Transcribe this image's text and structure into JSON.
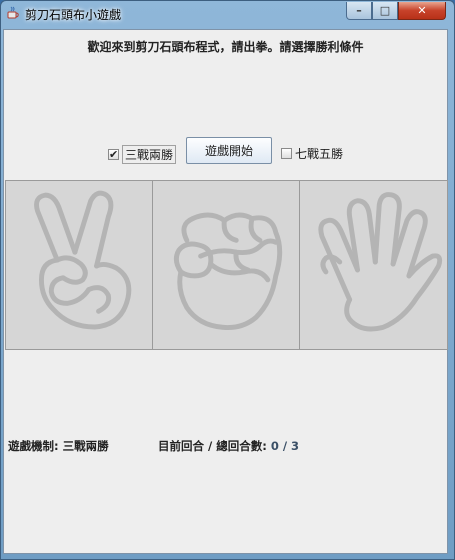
{
  "window": {
    "title": "剪刀石頭布小遊戲",
    "buttons": {
      "minimize": "–",
      "maximize": "□",
      "close": "✕"
    }
  },
  "welcome_text": "歡迎來到剪刀石頭布程式，請出拳。請選擇勝利條件",
  "options": {
    "best_of_three": {
      "label": "三戰兩勝",
      "checked": true
    },
    "start_button": "遊戲開始",
    "best_of_seven": {
      "label": "七戰五勝",
      "checked": false
    }
  },
  "hands": [
    {
      "name": "scissors",
      "icon": "scissors-hand-icon"
    },
    {
      "name": "rock",
      "icon": "rock-fist-icon"
    },
    {
      "name": "paper",
      "icon": "paper-palm-icon"
    }
  ],
  "status": {
    "mode_label": "遊戲機制:",
    "mode_value": "三戰兩勝",
    "round_label": "目前回合 / 總回合數:",
    "round_value": "0 / 3"
  }
}
